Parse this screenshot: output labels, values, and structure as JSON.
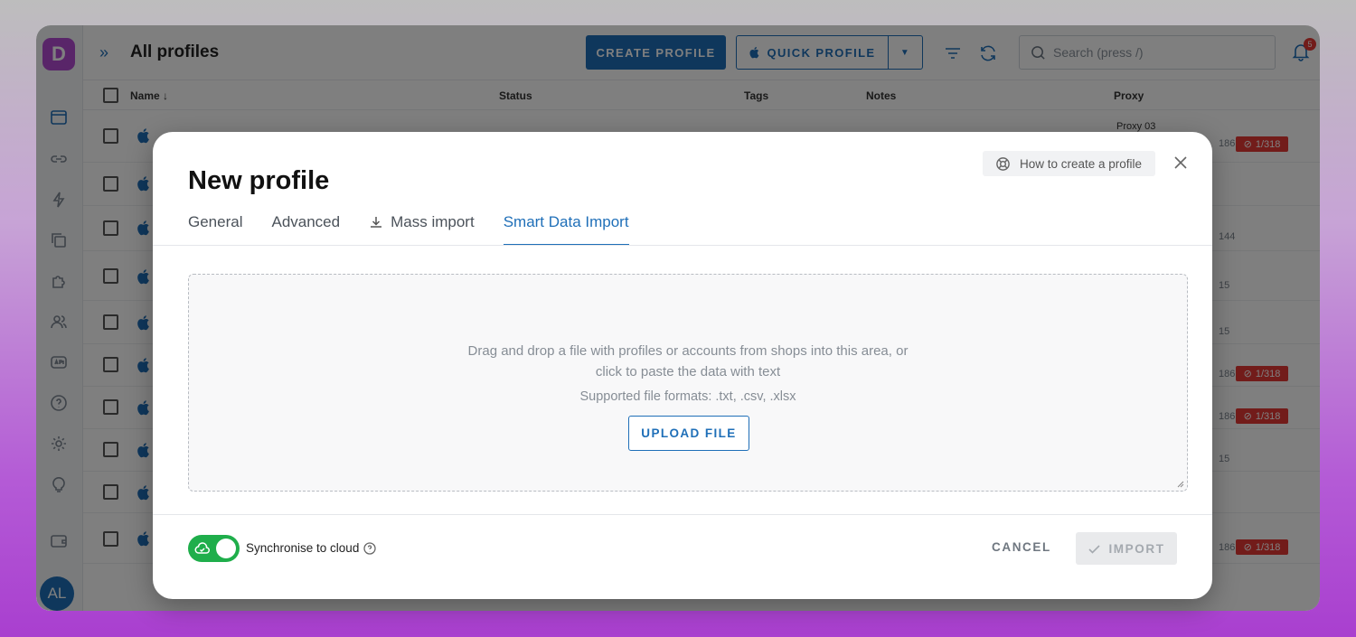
{
  "app": {
    "logo_letter": "D",
    "avatar_initials": "AL"
  },
  "header": {
    "title": "All profiles",
    "create_label": "CREATE PROFILE",
    "quick_label": "QUICK PROFILE",
    "search_placeholder": "Search (press /)",
    "notifications_count": "5"
  },
  "table": {
    "columns": {
      "name": "Name",
      "status": "Status",
      "tags": "Tags",
      "notes": "Notes",
      "proxy": "Proxy"
    },
    "proxy_first": "Proxy 03",
    "rows": [
      {
        "right": "186",
        "ban": "1/318"
      },
      {
        "right": "",
        "ban": ""
      },
      {
        "right": "144",
        "ban": ""
      },
      {
        "right": "15",
        "ban": ""
      },
      {
        "right": "15",
        "ban": ""
      },
      {
        "right": "186",
        "ban": "1/318"
      },
      {
        "right": "186",
        "ban": "1/318"
      },
      {
        "right": "15",
        "ban": ""
      },
      {
        "right": "",
        "ban": ""
      },
      {
        "right": "186",
        "ban": "1/318"
      }
    ]
  },
  "modal": {
    "help_label": "How to create a profile",
    "title": "New profile",
    "tabs": [
      "General",
      "Advanced",
      "Mass import",
      "Smart Data Import"
    ],
    "active_tab": "Smart Data Import",
    "drop_text_line1": "Drag and drop a file with profiles or accounts from shops into this area, or",
    "drop_text_line2": "click to paste the data with text",
    "formats": "Supported file formats: .txt, .csv, .xlsx",
    "upload_label": "UPLOAD FILE",
    "sync_label": "Synchronise to cloud",
    "sync_on": true,
    "cancel_label": "CANCEL",
    "import_label": "IMPORT"
  },
  "colors": {
    "accent": "#1f6fb8",
    "toggle_on": "#1fae4b",
    "ban": "#e53935",
    "brand": "#b24bd3"
  }
}
